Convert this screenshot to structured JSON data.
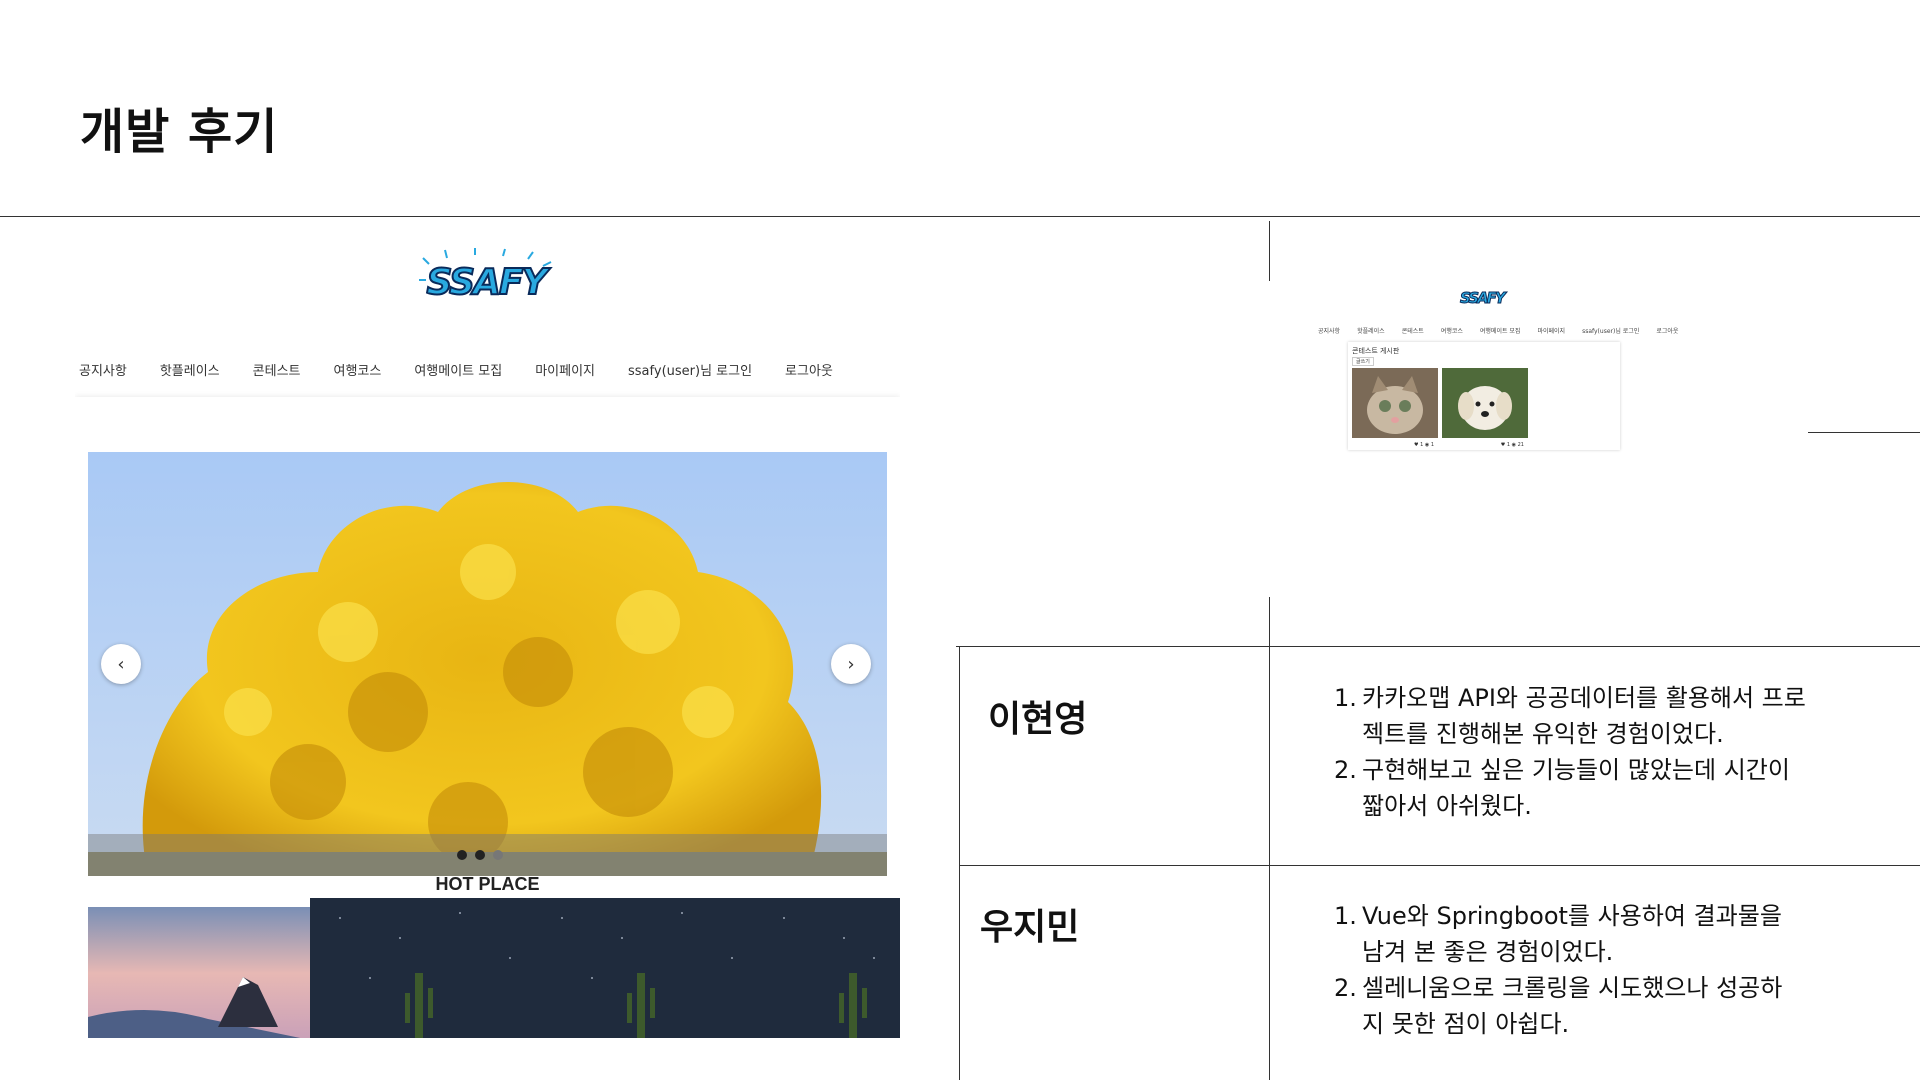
{
  "slide": {
    "title": "개발 후기"
  },
  "main_screenshot": {
    "logo_text": "SSAFY",
    "nav": [
      "공지사항",
      "핫플레이스",
      "콘테스트",
      "여행코스",
      "여행메이트 모집",
      "마이페이지",
      "ssafy(user)님 로그인",
      "로그아웃"
    ],
    "carousel": {
      "prev_icon": "‹",
      "next_icon": "›",
      "slide_count": 3,
      "active_index": 1
    },
    "hot_place_title": "HOT PLACE"
  },
  "small_screenshot": {
    "logo_text": "SSAFY",
    "nav": [
      "공지사항",
      "핫플레이스",
      "콘테스트",
      "여행코스",
      "여행메이트 모집",
      "마이페이지",
      "ssafy(user)님 로그인",
      "로그아웃"
    ],
    "board_title": "콘테스트 게시판",
    "write_button": "글쓰기",
    "cards": [
      {
        "image": "cat-photo",
        "likes": "1",
        "views": "1"
      },
      {
        "image": "puppy-photo",
        "likes": "1",
        "views": "21"
      }
    ]
  },
  "reviews": [
    {
      "name": "이현영",
      "items": [
        {
          "num": "1.",
          "lines": [
            "카카오맵 API와 공공데이터를 활용해서 프로",
            "젝트를 진행해본 유익한 경험이었다."
          ]
        },
        {
          "num": "2.",
          "lines": [
            "구현해보고 싶은 기능들이 많았는데 시간이",
            "짧아서 아쉬웠다."
          ]
        }
      ]
    },
    {
      "name": "우지민",
      "items": [
        {
          "num": "1.",
          "lines": [
            "Vue와 Springboot를 사용하여 결과물을",
            "남겨 본 좋은 경험이었다."
          ]
        },
        {
          "num": "2.",
          "lines": [
            "셀레니움으로 크롤링을 시도했으나 성공하",
            "지 못한 점이 아쉽다."
          ]
        }
      ]
    }
  ]
}
